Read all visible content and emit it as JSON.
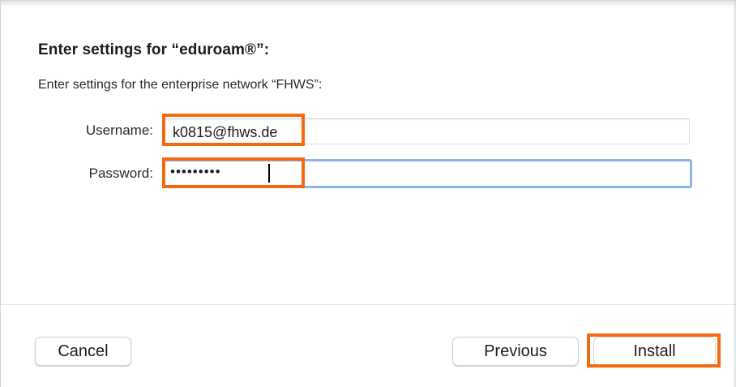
{
  "dialog": {
    "title": "Enter settings for “eduroam®”:",
    "subtitle": "Enter settings for the enterprise network “FHWS”:"
  },
  "form": {
    "username": {
      "label": "Username:",
      "value": "k0815@fhws.de"
    },
    "password": {
      "label": "Password:",
      "value": "•••••••••",
      "focused": true
    }
  },
  "buttons": {
    "cancel": "Cancel",
    "previous": "Previous",
    "install": "Install"
  },
  "colors": {
    "highlight": "#f26b12",
    "focus_ring": "#8db5f0"
  }
}
